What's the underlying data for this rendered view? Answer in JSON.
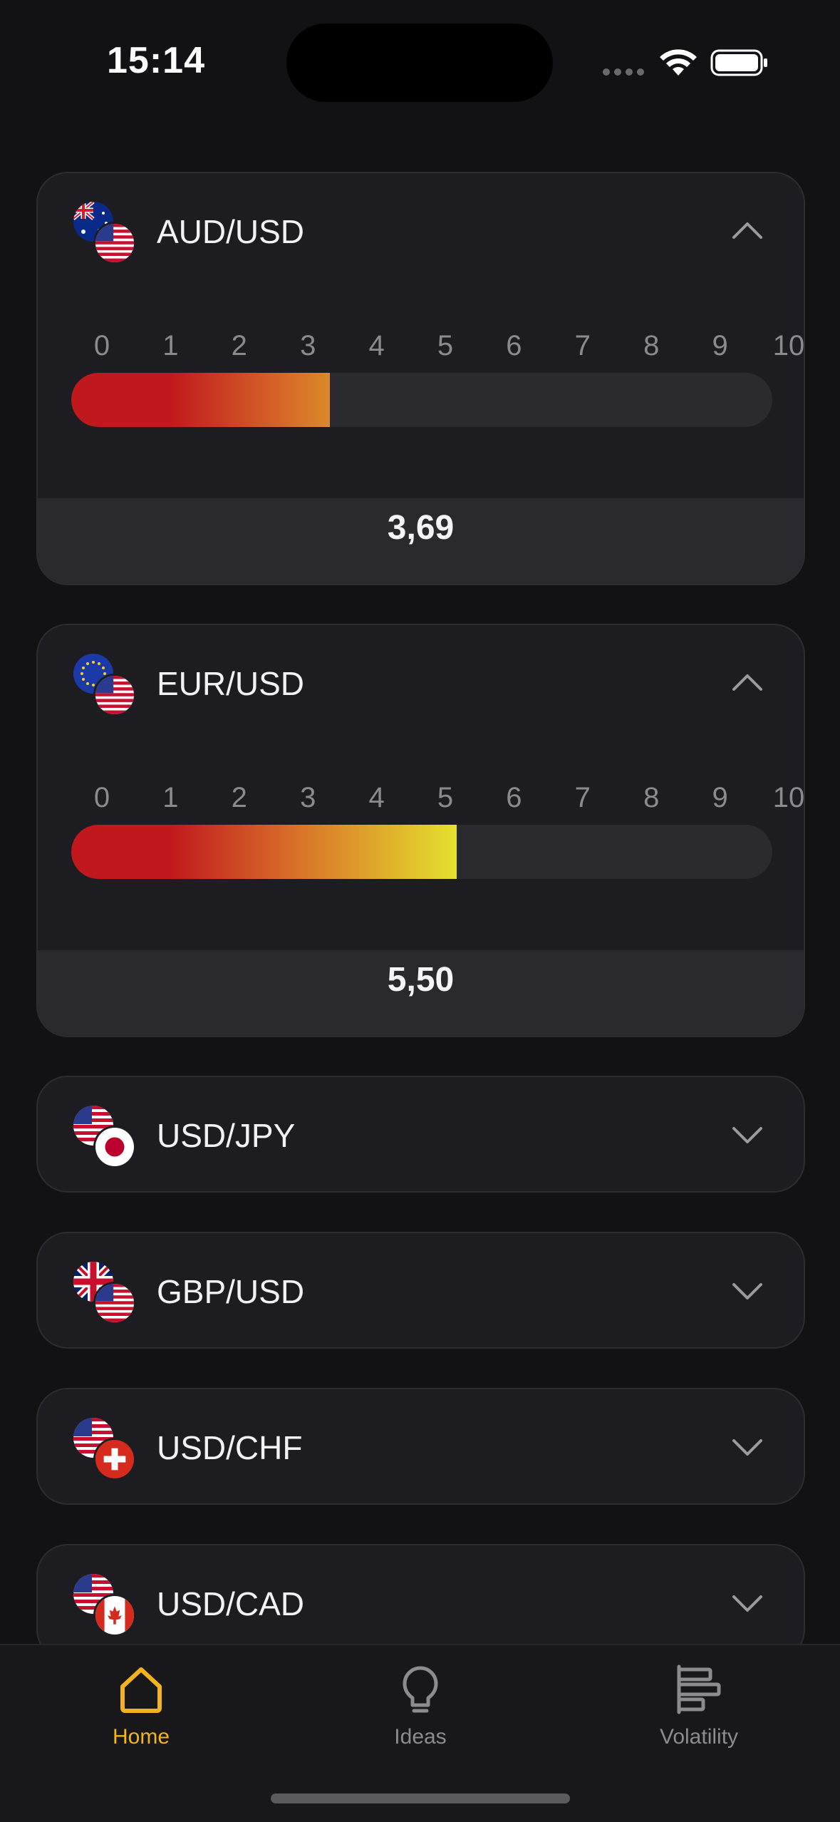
{
  "status_bar": {
    "time": "15:14"
  },
  "scale_ticks": [
    "0",
    "1",
    "2",
    "3",
    "4",
    "5",
    "6",
    "7",
    "8",
    "9",
    "10"
  ],
  "cards": [
    {
      "pair": "AUD/USD",
      "expanded": true,
      "value": "3,69",
      "score": 3.69
    },
    {
      "pair": "EUR/USD",
      "expanded": true,
      "value": "5,50",
      "score": 5.5
    },
    {
      "pair": "USD/JPY",
      "expanded": false
    },
    {
      "pair": "GBP/USD",
      "expanded": false
    },
    {
      "pair": "USD/CHF",
      "expanded": false
    },
    {
      "pair": "USD/CAD",
      "expanded": false
    }
  ],
  "tabs": [
    {
      "label": "Home",
      "icon": "house-icon",
      "active": true
    },
    {
      "label": "Ideas",
      "icon": "lightbulb-icon",
      "active": false
    },
    {
      "label": "Volatility",
      "icon": "bars-icon",
      "active": false
    }
  ],
  "colors": {
    "accent": "#f2b31d",
    "gradient_red": "#c0181d",
    "gradient_orange": "#d9702a",
    "gradient_yellow": "#e5e12e",
    "card_bg": "#1d1d21",
    "page_bg": "#121214"
  }
}
